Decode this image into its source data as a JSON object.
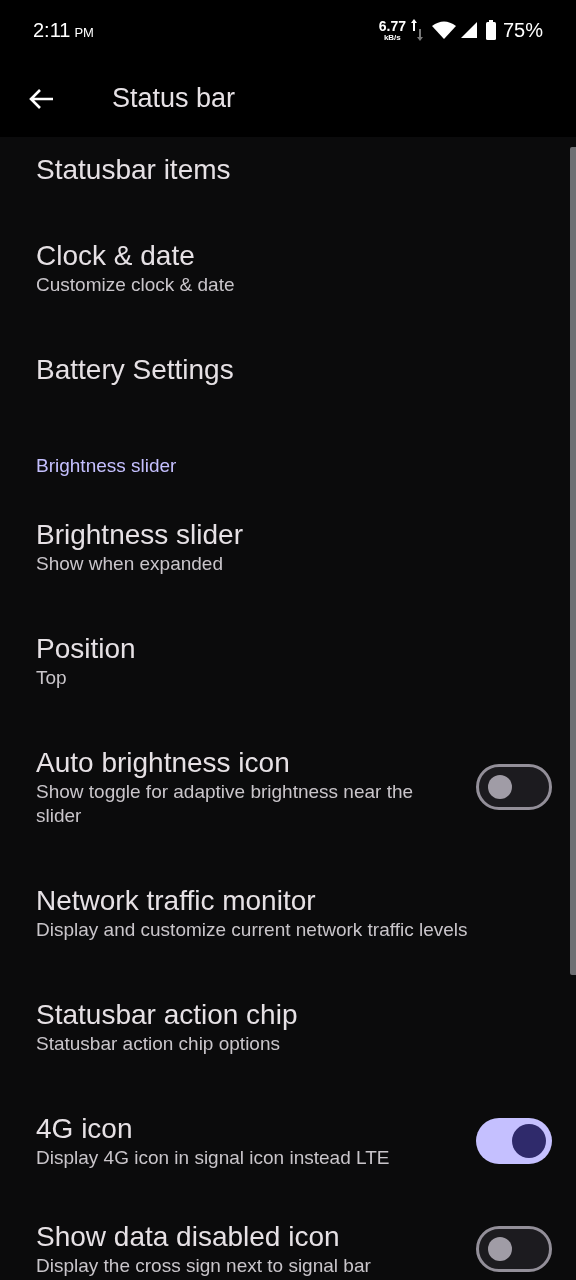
{
  "status_bar": {
    "time": "2:11",
    "meridiem": "PM",
    "net_speed": "6.77",
    "net_unit": "kB/s",
    "battery": "75%"
  },
  "app_bar": {
    "title": "Status bar"
  },
  "items": [
    {
      "kind": "setting",
      "title": "Statusbar items"
    },
    {
      "kind": "setting",
      "title": "Clock & date",
      "subtitle": "Customize clock & date"
    },
    {
      "kind": "setting",
      "title": "Battery Settings"
    },
    {
      "kind": "header",
      "title": "Brightness slider"
    },
    {
      "kind": "setting",
      "title": "Brightness slider",
      "subtitle": "Show when expanded"
    },
    {
      "kind": "setting",
      "title": "Position",
      "subtitle": "Top"
    },
    {
      "kind": "toggle",
      "title": "Auto brightness icon",
      "subtitle": "Show toggle for adaptive brightness near the slider",
      "on": false
    },
    {
      "kind": "setting",
      "title": "Network traffic monitor",
      "subtitle": "Display and customize current network traffic levels"
    },
    {
      "kind": "setting",
      "title": "Statusbar action chip",
      "subtitle": "Statusbar action chip options"
    },
    {
      "kind": "toggle",
      "title": "4G icon",
      "subtitle": "Display 4G icon in signal icon instead LTE",
      "on": true
    },
    {
      "kind": "toggle",
      "title": "Show data disabled icon",
      "subtitle": "Display the cross sign next to signal bar",
      "on": false
    }
  ]
}
